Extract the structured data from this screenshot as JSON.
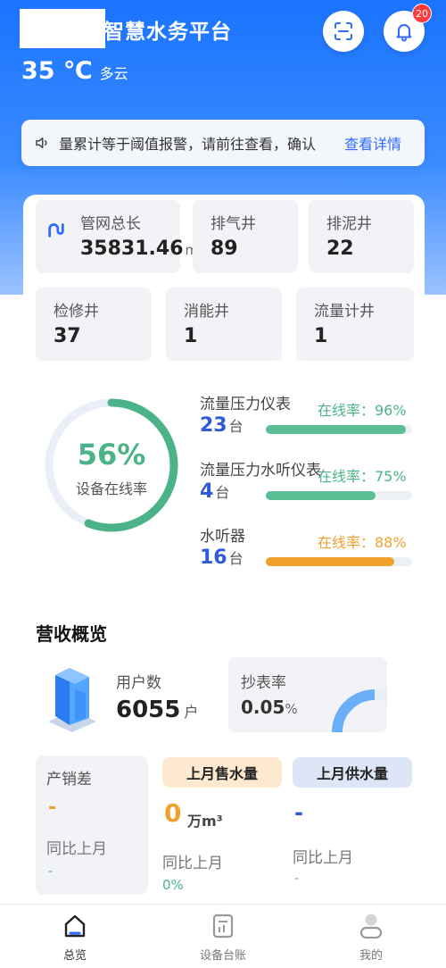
{
  "header": {
    "title": "智慧水务平台",
    "temperature": "35 ℃",
    "weather": "多云",
    "notification_count": "20"
  },
  "notice": {
    "text": "量累计等于阈值报警，请前往查看，确认",
    "link": "查看详情"
  },
  "stats": {
    "pipe_length": {
      "label": "管网总长",
      "value": "35831.46",
      "unit": "m"
    },
    "exhaust_well": {
      "label": "排气井",
      "value": "89"
    },
    "mud_well": {
      "label": "排泥井",
      "value": "22"
    },
    "repair_well": {
      "label": "检修井",
      "value": "37"
    },
    "energy_well": {
      "label": "消能井",
      "value": "1"
    },
    "flow_well": {
      "label": "流量计井",
      "value": "1"
    }
  },
  "online": {
    "percent": "56%",
    "percent_value": 0.56,
    "label": "设备在线率",
    "devices": [
      {
        "name": "流量压力仪表",
        "count": "23",
        "unit": "台",
        "rate": "在线率：96%",
        "fraction": 0.96,
        "color": "#5bbf96"
      },
      {
        "name": "流量压力水听仪表",
        "count": "4",
        "unit": "台",
        "rate": "在线率：75%",
        "fraction": 0.75,
        "color": "#5bbf96"
      },
      {
        "name": "水听器",
        "count": "16",
        "unit": "台",
        "rate": "在线率：88%",
        "fraction": 0.88,
        "color": "#f0a02f"
      }
    ]
  },
  "revenue": {
    "title": "营收概览",
    "users_label": "用户数",
    "users_value": "6055",
    "users_unit": "户",
    "meter_label": "抄表率",
    "meter_value": "0.05",
    "meter_unit": "%",
    "diff_label": "产销差",
    "diff_value": "-",
    "diff_compare_label": "同比上月",
    "diff_compare_value": "-",
    "sold_label": "上月售水量",
    "sold_value": "0",
    "sold_unit": "万m³",
    "sold_compare_label": "同比上月",
    "sold_compare_value": "0%",
    "supply_label": "上月供水量",
    "supply_value": "-",
    "supply_compare_label": "同比上月",
    "supply_compare_value": "-"
  },
  "nav": {
    "overview": "总览",
    "ledger": "设备台账",
    "mine": "我的"
  },
  "colors": {
    "primary": "#1a73ff",
    "green": "#4cb388",
    "orange": "#f0a02f",
    "badge": "#ff3b3b"
  }
}
